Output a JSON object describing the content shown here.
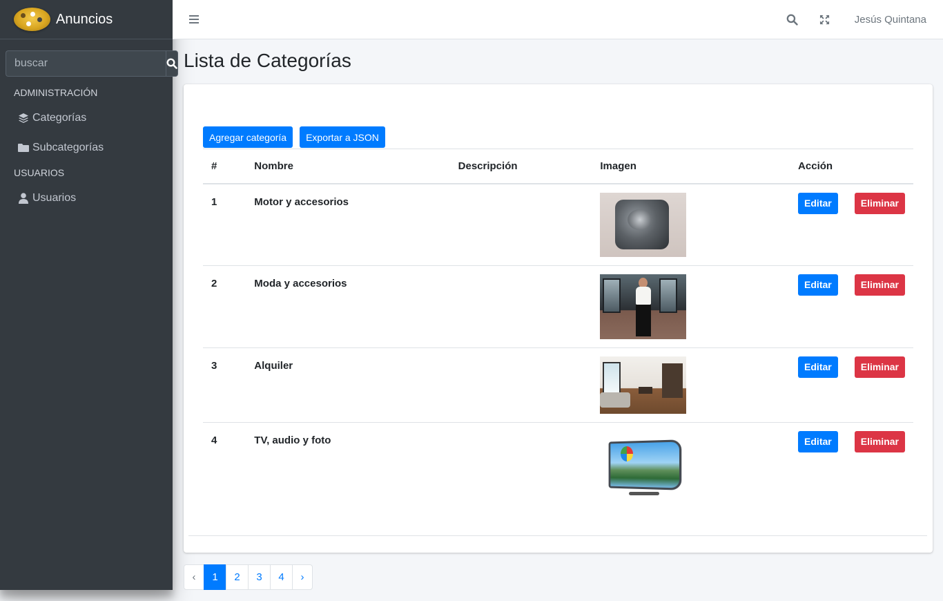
{
  "app": {
    "title": "Anuncios"
  },
  "sidebar": {
    "search_placeholder": "buscar",
    "sections": [
      {
        "header": "ADMINISTRACIÓN"
      },
      {
        "header": "USUARIOS"
      }
    ],
    "items": [
      {
        "label": "Categorías",
        "icon": "layers-icon"
      },
      {
        "label": "Subcategorías",
        "icon": "folder-icon"
      },
      {
        "label": "Usuarios",
        "icon": "user-icon"
      }
    ]
  },
  "topbar": {
    "user_name": "Jesús Quintana",
    "icons": [
      "menu-icon",
      "search-icon",
      "fullscreen-icon"
    ]
  },
  "main": {
    "page_title": "Lista de Categorías",
    "add_button": "Agregar categoría",
    "export_button": "Exportar a JSON",
    "table": {
      "headers": [
        "#",
        "Nombre",
        "Descripción",
        "Imagen",
        "Acción"
      ],
      "rows": [
        {
          "id": "1",
          "nombre": "Motor y accesorios",
          "descripcion": "",
          "image": "engine"
        },
        {
          "id": "2",
          "nombre": "Moda y accesorios",
          "descripcion": "",
          "image": "fashion"
        },
        {
          "id": "3",
          "nombre": "Alquiler",
          "descripcion": "",
          "image": "apartment"
        },
        {
          "id": "4",
          "nombre": "TV, audio y foto",
          "descripcion": "",
          "image": "television"
        }
      ],
      "edit_label": "Editar",
      "delete_label": "Eliminar"
    }
  },
  "pagination": {
    "prev": "‹",
    "pages": [
      "1",
      "2",
      "3",
      "4"
    ],
    "next": "›",
    "active": "1"
  },
  "colors": {
    "sidebar_bg": "#343a40",
    "primary": "#007bff",
    "danger": "#dc3545"
  }
}
